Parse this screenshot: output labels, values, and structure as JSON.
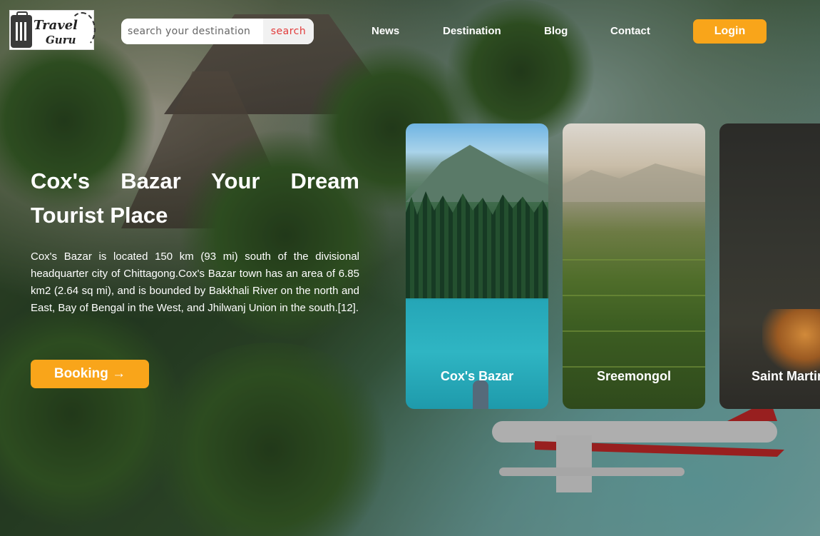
{
  "header": {
    "logo": {
      "line1": "Travel",
      "line2": "Guru"
    },
    "search": {
      "placeholder": "search your destination",
      "button_label": "search"
    },
    "nav": [
      "News",
      "Destination",
      "Blog",
      "Contact"
    ],
    "login_label": "Login"
  },
  "hero": {
    "title_line1": "Cox's Bazar Your Dream",
    "title_line2": "Tourist Place",
    "description": "Cox's Bazar is located 150 km (93 mi) south of the divisional headquarter city of Chittagong.Cox's Bazar town has an area of 6.85 km2 (2.64 sq mi), and is bounded by Bakkhali River on the north and East, Bay of Bengal in the West, and Jhilwanj Union in the south.[12].",
    "booking_label": "Booking →"
  },
  "cards": [
    "Cox's Bazar",
    "Sreemongol",
    "Saint Martin"
  ],
  "colors": {
    "accent": "#f9a51a",
    "search_button_text": "#e23b3b"
  }
}
